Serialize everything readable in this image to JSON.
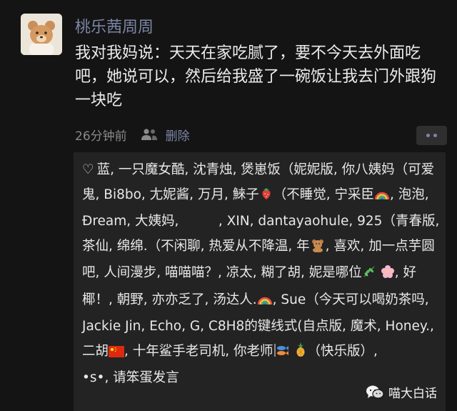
{
  "post": {
    "author": "桃乐茜周周",
    "text": "我对我妈说：天天在家吃腻了，要不今天去外面吃吧，她说可以，然后给我盛了一碗饭让我去门外跟狗一块吃",
    "time": "26分钟前",
    "delete_label": "删除"
  },
  "likes": {
    "seg1": "蓝, 一只魔女酷, 沈青烛, 煲崽饭（妮妮版, 你八姨妈（可爱鬼, Bi8bo, 尢妮酱, 万月, 鯠子",
    "seg2": "（不睡觉, 宁采臣",
    "seg3": ", 泡泡, Đream, 大姨妈,　　　, XIN, dantayaohule, 925（青春版, 茶仙, 绵绵.（不闲聊, 热爱从不降温, 年",
    "seg4": ", 喜欢, 加一点芋圆吧, 人间漫步, 喵喵喵？, 凉太, 糊了胡, 妮是哪位",
    "seg5": ", 好椰！, 朝野, 亦亦乏了, 汤达人.",
    "seg6": ", Sue（今天可以喝奶茶吗, Jackie Jin, Echo, G, C8H8的键线式(自点版, 魔术, Honey., 二胡",
    "seg7": ", 十年鲨手老司机, 你老师",
    "seg8": "（快乐版）,　　　　　　•s•, 请笨蛋发言"
  },
  "watermark": {
    "text": "喵大白话"
  },
  "icons": [
    "avatar-teddy-bear",
    "people-icon",
    "more-icon",
    "heart-icon",
    "strawberry-icon",
    "rainbow-icon",
    "teddy-bear-icon",
    "herb-icon",
    "flower-icon",
    "china-flag-icon",
    "fish-icon",
    "pineapple-icon",
    "wechat-icon"
  ],
  "colors": {
    "link": "#7c86a6",
    "background": "#141414",
    "likes_bg": "#232323"
  }
}
